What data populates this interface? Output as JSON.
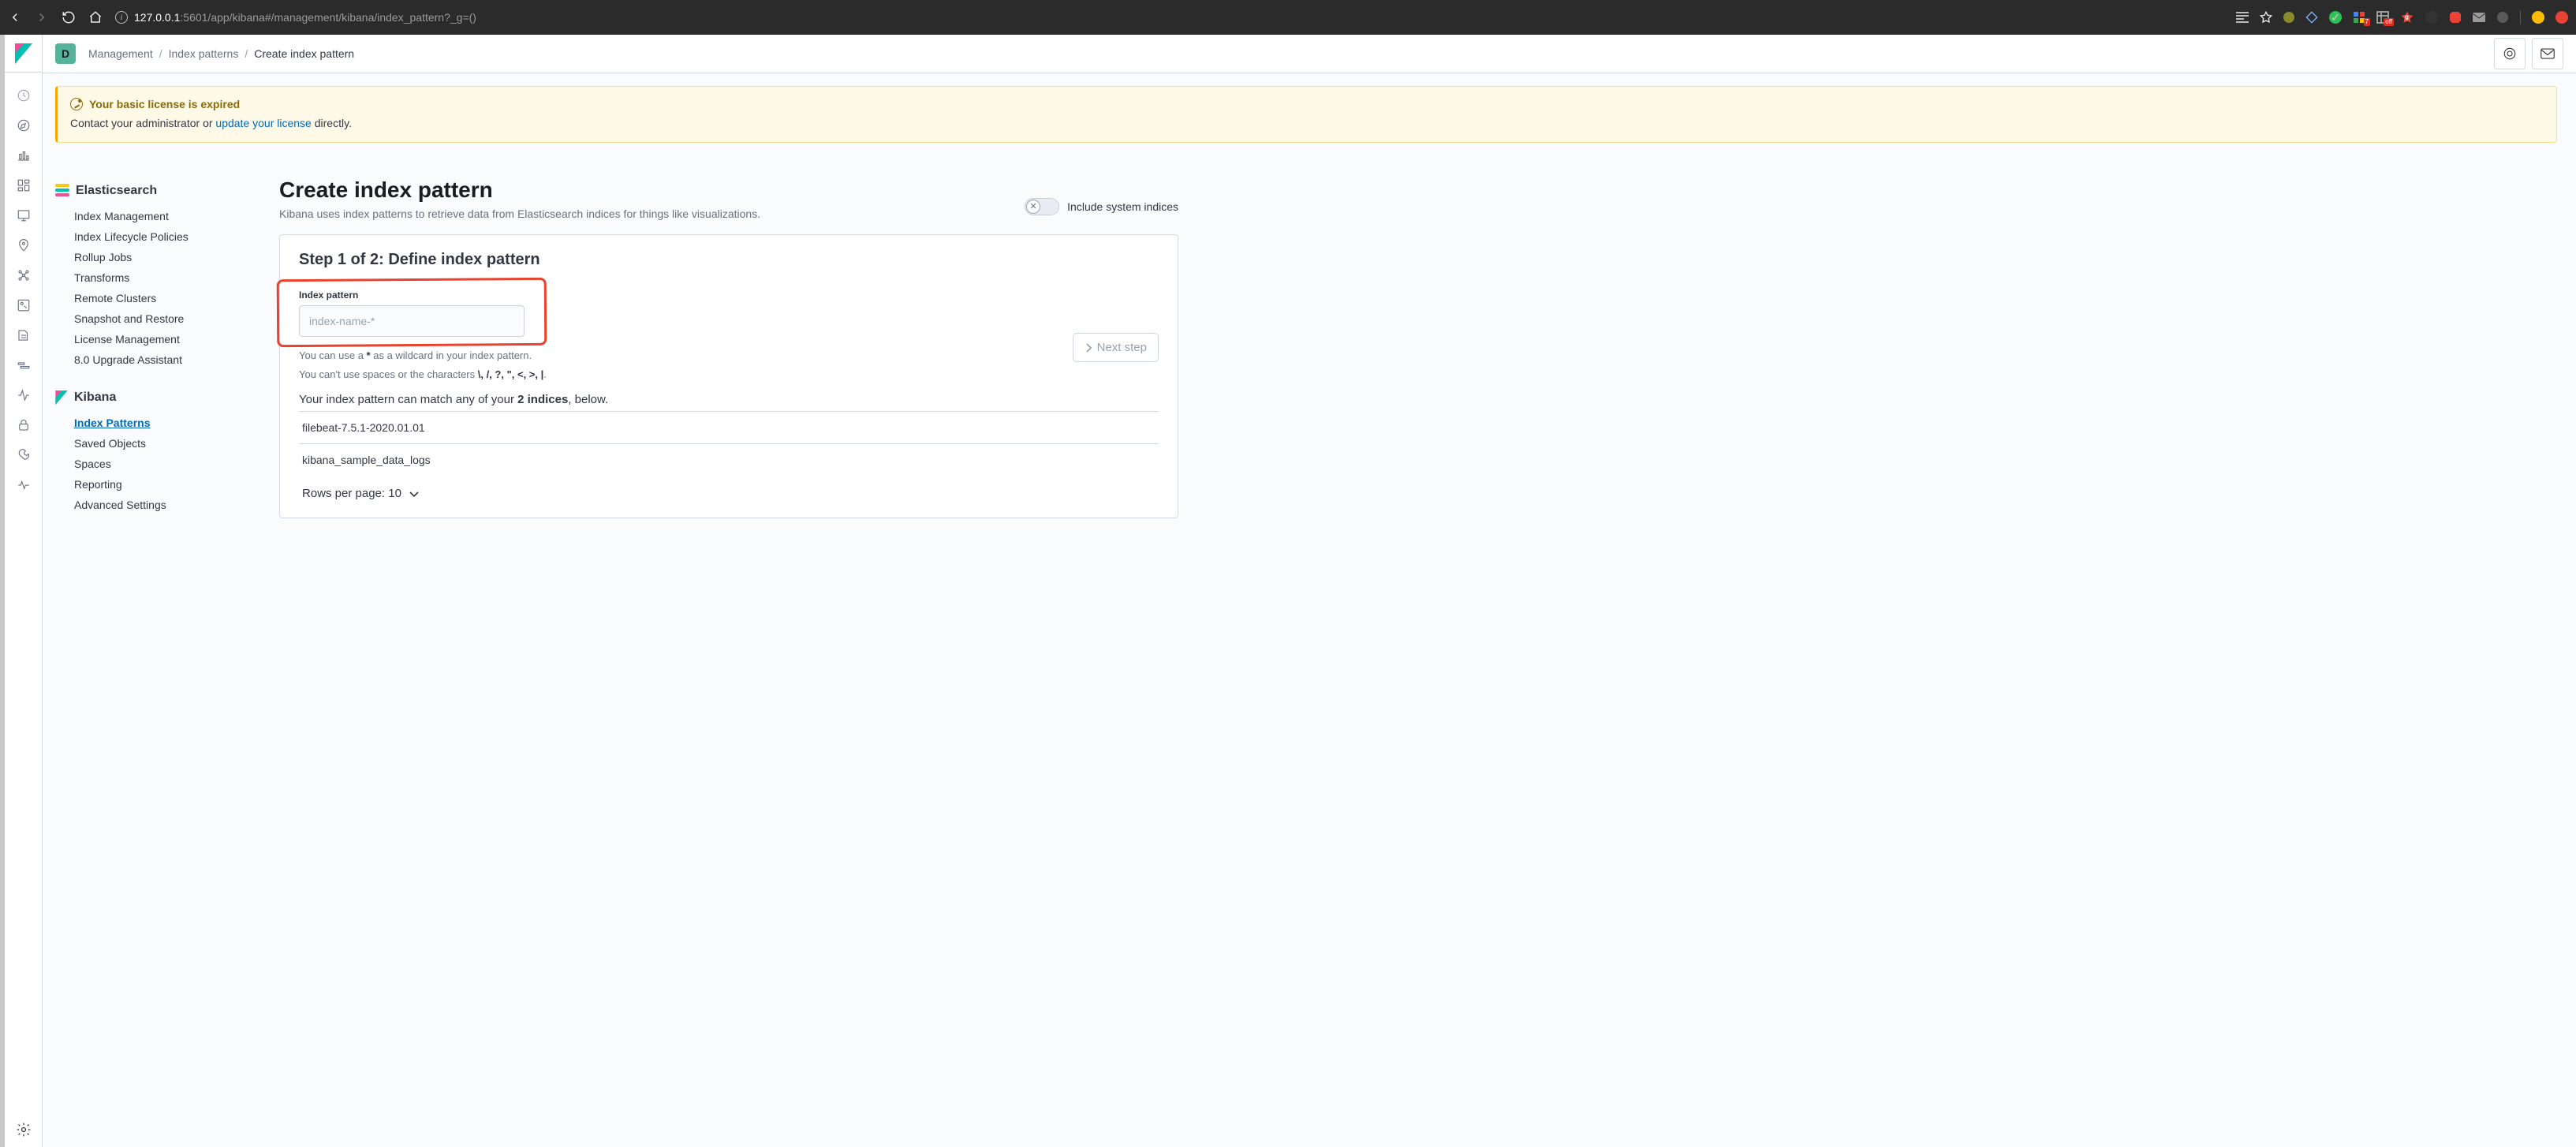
{
  "browser": {
    "url_host": "127.0.0.1",
    "url_path": ":5601/app/kibana#/management/kibana/index_pattern?_g=()",
    "ext_badge1": "7",
    "ext_badge2": "off"
  },
  "header": {
    "space_initial": "D",
    "crumbs": {
      "management": "Management",
      "index_patterns": "Index patterns",
      "current": "Create index pattern"
    }
  },
  "callout": {
    "title": "Your basic license is expired",
    "body_prefix": "Contact your administrator or ",
    "link": "update your license",
    "body_suffix": " directly."
  },
  "sidebar": {
    "es_title": "Elasticsearch",
    "es_items": [
      "Index Management",
      "Index Lifecycle Policies",
      "Rollup Jobs",
      "Transforms",
      "Remote Clusters",
      "Snapshot and Restore",
      "License Management",
      "8.0 Upgrade Assistant"
    ],
    "kb_title": "Kibana",
    "kb_items": [
      "Index Patterns",
      "Saved Objects",
      "Spaces",
      "Reporting",
      "Advanced Settings"
    ]
  },
  "page": {
    "title": "Create index pattern",
    "desc": "Kibana uses index patterns to retrieve data from Elasticsearch indices for things like visualizations.",
    "toggle_label": "Include system indices",
    "step_title": "Step 1 of 2: Define index pattern",
    "field_label": "Index pattern",
    "placeholder": "index-name-*",
    "help1_a": "You can use a ",
    "help1_b": "*",
    "help1_c": " as a wildcard in your index pattern.",
    "help2_a": "You can't use spaces or the characters ",
    "help2_b": "\\, /, ?, \", <, >, |",
    "help2_c": ".",
    "match_a": "Your index pattern can match any of your ",
    "match_b": "2 indices",
    "match_c": ", below.",
    "next": "Next step",
    "indices": [
      "filebeat-7.5.1-2020.01.01",
      "kibana_sample_data_logs"
    ],
    "rows_label": "Rows per page: 10"
  }
}
